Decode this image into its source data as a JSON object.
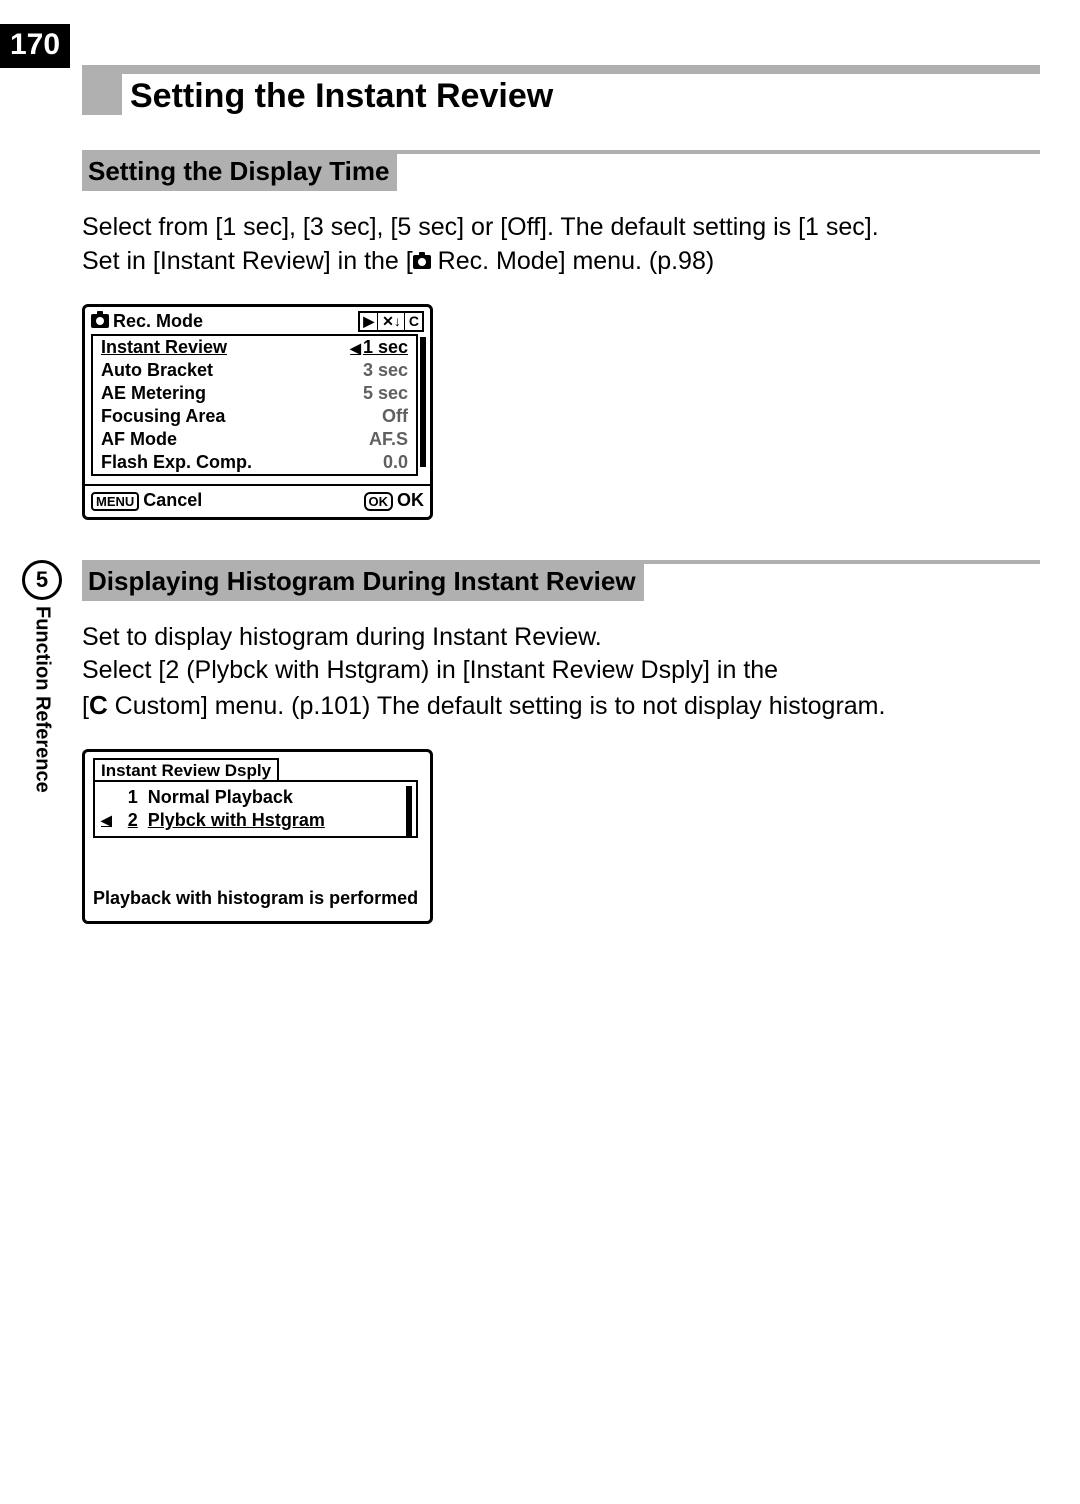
{
  "page_number": "170",
  "title": "Setting the Instant Review",
  "side_tab": {
    "number": "5",
    "label": "Function Reference"
  },
  "section1": {
    "heading": "Setting the Display Time",
    "text_part1": "Select from [1 sec], [3 sec], [5 sec] or [Off]. The default setting is [1 sec].",
    "text_part2a": "Set in [Instant Review] in the [",
    "text_part2b": " Rec. Mode] menu. (p.98)"
  },
  "menu1": {
    "header": "Rec. Mode",
    "rows": [
      {
        "label": "Instant Review",
        "value": "1 sec",
        "highlight": true,
        "arrow": true
      },
      {
        "label": "Auto Bracket",
        "value": "3 sec",
        "highlight": false
      },
      {
        "label": "AE Metering",
        "value": "5 sec",
        "highlight": false
      },
      {
        "label": "Focusing Area",
        "value": "Off",
        "highlight": false
      },
      {
        "label": "AF Mode",
        "value": "AF.S",
        "highlight": false
      },
      {
        "label": "Flash Exp. Comp.",
        "value": "0.0",
        "highlight": false
      }
    ],
    "cancel_btn": "MENU",
    "cancel_label": "Cancel",
    "ok_btn": "OK",
    "ok_label": "OK"
  },
  "section2": {
    "heading": "Displaying Histogram During Instant Review",
    "text1": "Set to display histogram during Instant Review.",
    "text2": "Select [2 (Plybck with Hstgram) in [Instant Review Dsply] in the",
    "text3a": "[",
    "text3_c": "C",
    "text3b": " Custom] menu. (p.101) The default setting is to not display histogram."
  },
  "menu2": {
    "tab": "Instant Review Dsply",
    "rows": [
      {
        "num": "1",
        "label": "Normal Playback",
        "selected": false
      },
      {
        "num": "2",
        "label": "Plybck with Hstgram",
        "selected": true
      }
    ],
    "desc": "Playback with histogram is performed"
  }
}
